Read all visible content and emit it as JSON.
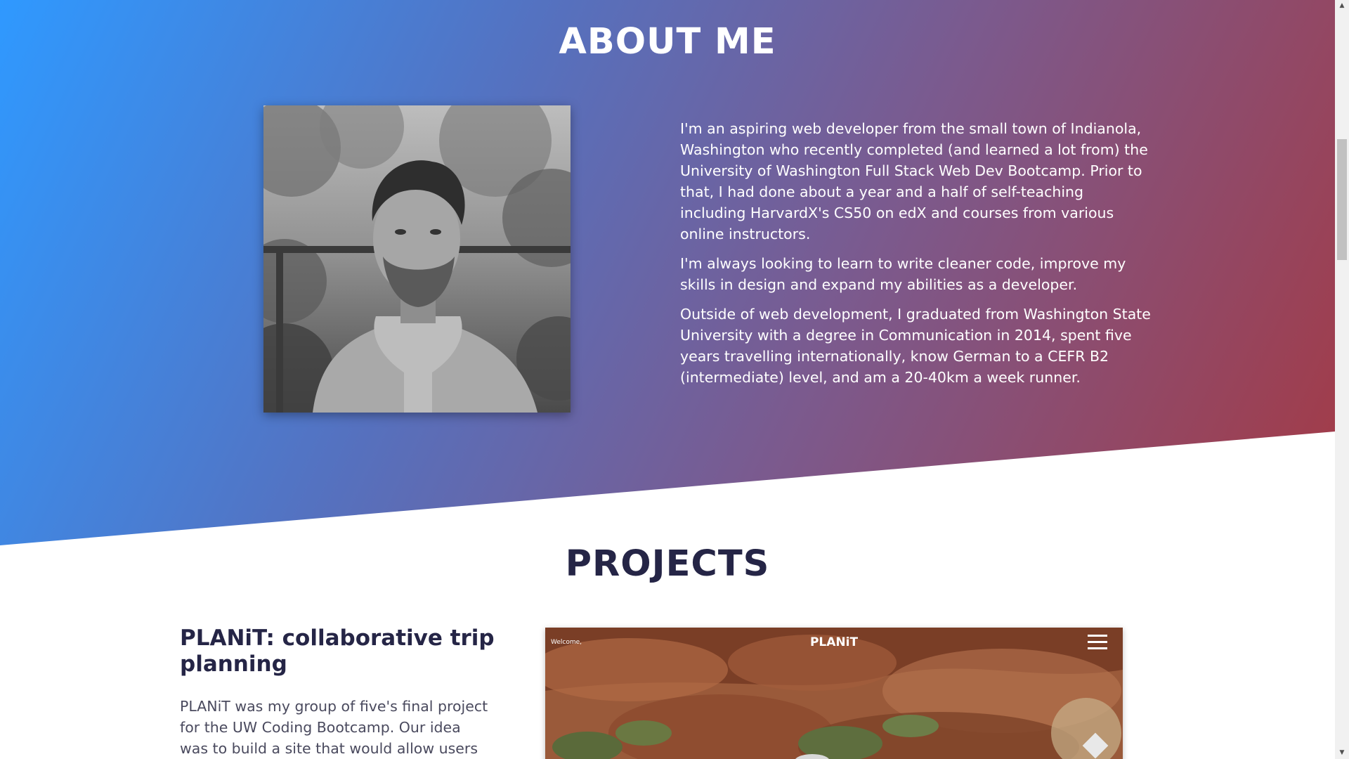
{
  "about": {
    "title": "ABOUT ME",
    "paragraphs": [
      "I'm an aspiring web developer from the small town of Indianola, Washington who recently completed (and learned a lot from) the University of Washington Full Stack Web Dev Bootcamp. Prior to that, I had done about a year and a half of self-teaching including HarvardX's CS50 on edX and courses from various online instructors.",
      "I'm always looking to learn to write cleaner code, improve my skills in design and expand my abilities as a developer.",
      "Outside of web development, I graduated from Washington State University with a degree in Communication in 2014, spent five years travelling internationally, know German to a CEFR B2 (intermediate) level, and am a 20-40km a week runner."
    ],
    "photo_description": "black-and-white portrait photo"
  },
  "projects": {
    "title": "PROJECTS",
    "items": [
      {
        "name": "PLANiT: collaborative trip planning",
        "description": "PLANiT was my group of five's final project for the UW Coding Bootcamp. Our idea was to build a site that would allow users to",
        "screenshot": {
          "welcome": "Welcome,",
          "brand": "PLANiT",
          "menu_icon": "hamburger-menu-icon"
        }
      }
    ]
  },
  "colors": {
    "gradient_start": "#2f99ff",
    "gradient_mid": "#7b5a8e",
    "gradient_end": "#a43a45",
    "heading_dark": "#252546",
    "body_text": "#4a4a5e"
  },
  "scrollbar": {
    "up_icon": "scroll-up-arrow-icon",
    "down_icon": "scroll-down-arrow-icon"
  }
}
